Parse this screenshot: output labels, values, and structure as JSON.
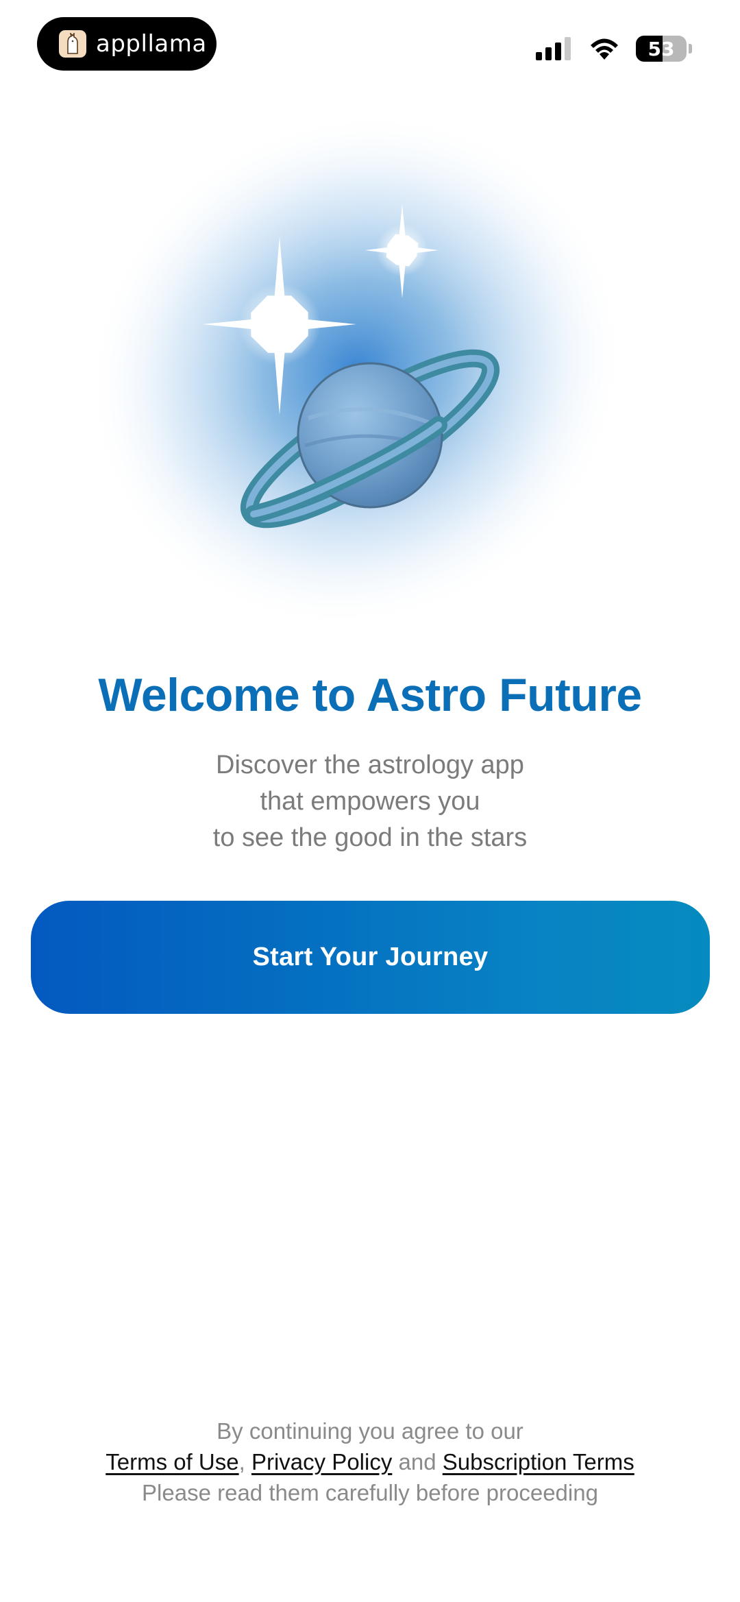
{
  "status_bar": {
    "brand": "appllama",
    "battery_level": "53",
    "battery_fraction": 0.53,
    "icons": [
      "llama-logo-icon",
      "cellular-signal-icon",
      "wifi-icon",
      "battery-icon"
    ]
  },
  "hero": {
    "icons": [
      "planet-icon",
      "sparkle-star-icon"
    ],
    "colors": {
      "glow": "#5b9fd8",
      "planet": "#6f9ecb",
      "ring": "#3e8aa0"
    }
  },
  "welcome": {
    "title": "Welcome to Astro Future",
    "subtitle_lines": [
      "Discover the astrology app",
      "that empowers you",
      "to see the good in the stars"
    ]
  },
  "cta": {
    "label": "Start Your Journey"
  },
  "legal": {
    "line1": "By continuing you agree to our",
    "terms_link": "Terms of Use",
    "comma": ",",
    "privacy_link": "Privacy Policy",
    "and": "and",
    "subscription_link": "Subscription Terms",
    "line3": "Please read them carefully before proceeding"
  },
  "colors": {
    "title": "#0b6fb8",
    "button_start": "#0459c0",
    "button_end": "#058bbf",
    "text_muted": "#7b7b7b"
  }
}
